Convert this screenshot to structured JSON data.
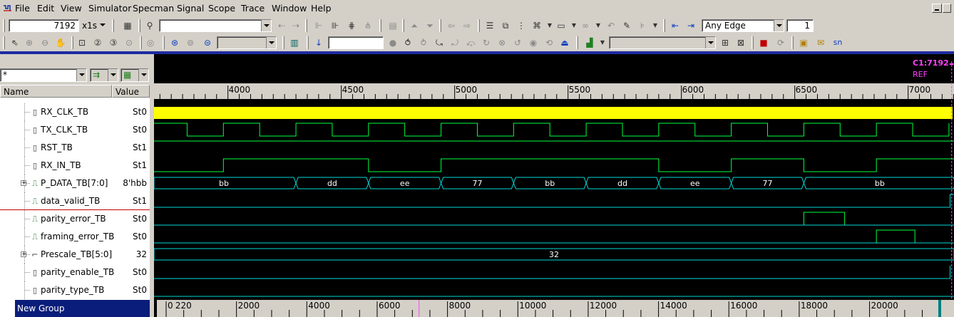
{
  "menu": [
    "File",
    "Edit",
    "View",
    "Simulator",
    "Specman",
    "Signal",
    "Scope",
    "Trace",
    "Window",
    "Help"
  ],
  "menu_underline": [
    "F",
    "E",
    "V",
    "i",
    "p",
    "S",
    "c",
    "T",
    "W",
    "H"
  ],
  "toolbar1": {
    "time_value": "7192",
    "time_unit": "x1s",
    "search_value": "",
    "edge_mode": "Any Edge",
    "edge_count": "1"
  },
  "toolbar2": {
    "scope_value": "",
    "jump_value": "",
    "marker_value": ""
  },
  "left": {
    "filter_value": "*",
    "col_name": "Name",
    "col_value": "Value",
    "group_label": "New Group"
  },
  "cursor": {
    "label": "C1:7192",
    "ref": "REF"
  },
  "signals": [
    {
      "name": "RX_CLK_TB",
      "value": "St0",
      "type": "bit",
      "expandable": false
    },
    {
      "name": "TX_CLK_TB",
      "value": "St0",
      "type": "bit",
      "expandable": false
    },
    {
      "name": "RST_TB",
      "value": "St1",
      "type": "bit",
      "expandable": false
    },
    {
      "name": "RX_IN_TB",
      "value": "St1",
      "type": "bit",
      "expandable": false
    },
    {
      "name": "P_DATA_TB[7:0]",
      "value": "8'hbb",
      "type": "bus",
      "expandable": true
    },
    {
      "name": "data_valid_TB",
      "value": "St1",
      "type": "wire",
      "expandable": false
    },
    {
      "name": "parity_error_TB",
      "value": "St0",
      "type": "wire",
      "expandable": false
    },
    {
      "name": "framing_error_TB",
      "value": "St0",
      "type": "wire",
      "expandable": false
    },
    {
      "name": "Prescale_TB[5:0]",
      "value": "32",
      "type": "bus",
      "expandable": true
    },
    {
      "name": "parity_enable_TB",
      "value": "St0",
      "type": "bit",
      "expandable": false
    },
    {
      "name": "parity_type_TB",
      "value": "St0",
      "type": "bit",
      "expandable": false
    }
  ],
  "ruler_top": {
    "labels": [
      "4000",
      "4500",
      "5000",
      "5500",
      "6000",
      "6500",
      "7000"
    ]
  },
  "ruler_bottom": {
    "labels": [
      "0",
      "2000",
      "4000",
      "6000",
      "8000",
      "10000",
      "12000",
      "14000",
      "16000",
      "18000",
      "20000",
      "220"
    ]
  },
  "waves": {
    "p_data_segments": [
      "bb",
      "dd",
      "ee",
      "77",
      "bb",
      "dd",
      "ee",
      "77",
      "bb"
    ],
    "prescale_value": "32"
  },
  "colors": {
    "wave_bg": "#000000",
    "wave_green": "#00ff40",
    "wave_cyan": "#00d8d8",
    "clock_yellow": "#ffff00",
    "cursor_magenta": "#ff40ff",
    "group_bg": "#0a1d7a",
    "accent_line": "#1e2ba0"
  }
}
